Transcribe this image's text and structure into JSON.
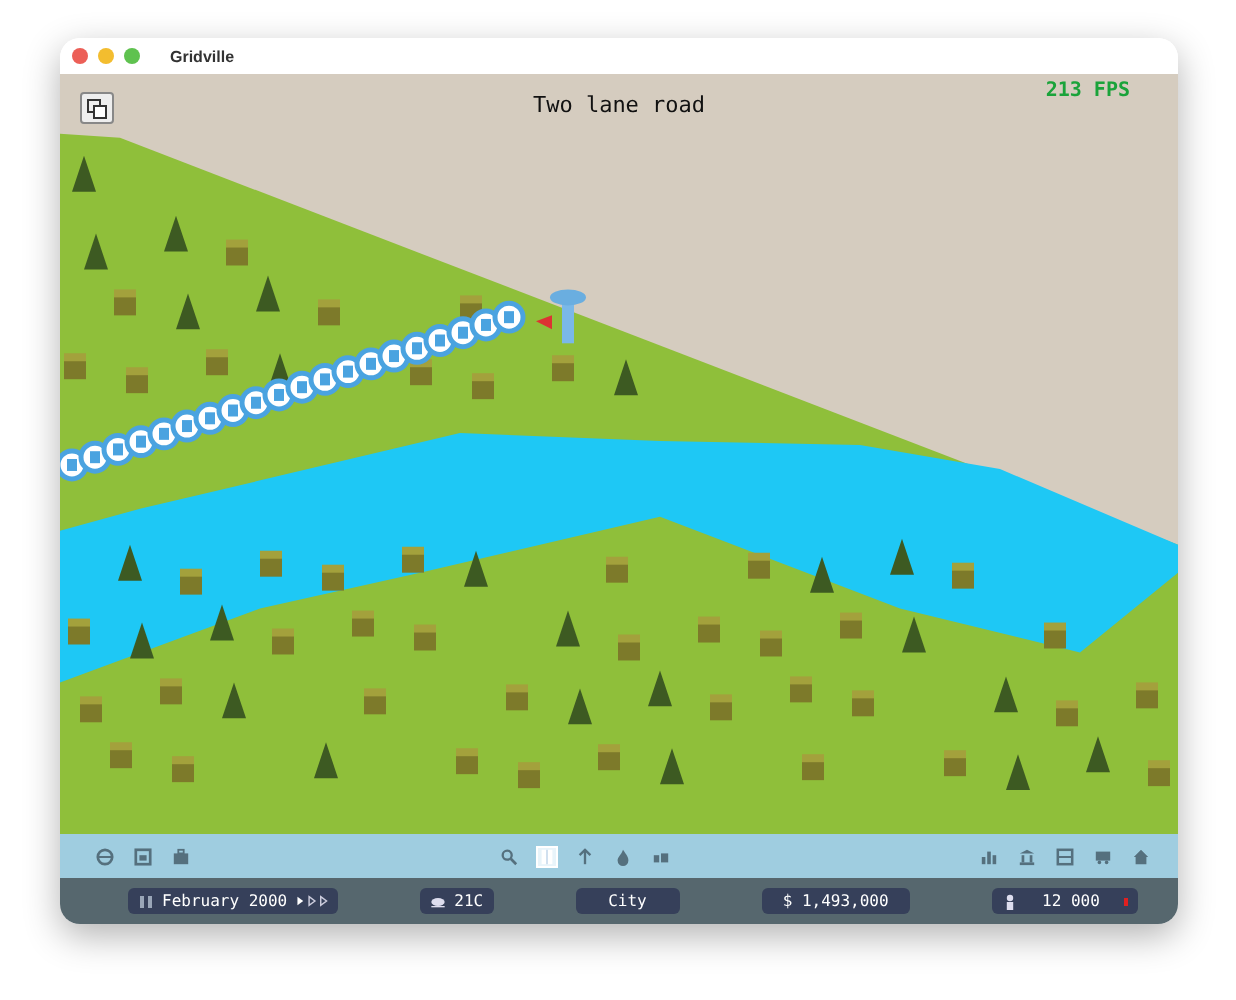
{
  "window": {
    "title": "Gridville"
  },
  "scene": {
    "tool_title": "Two lane road",
    "fps": "213 FPS"
  },
  "tools": [
    {
      "selected": false
    },
    {
      "selected": true
    },
    {
      "selected": false
    },
    {
      "selected": false
    },
    {
      "selected": false
    }
  ],
  "status_bar": {
    "date": "February 2000",
    "paused": false,
    "temperature": "21C",
    "view": "City",
    "money": "$ 1,493,000",
    "population": "12 000",
    "alert": true
  }
}
